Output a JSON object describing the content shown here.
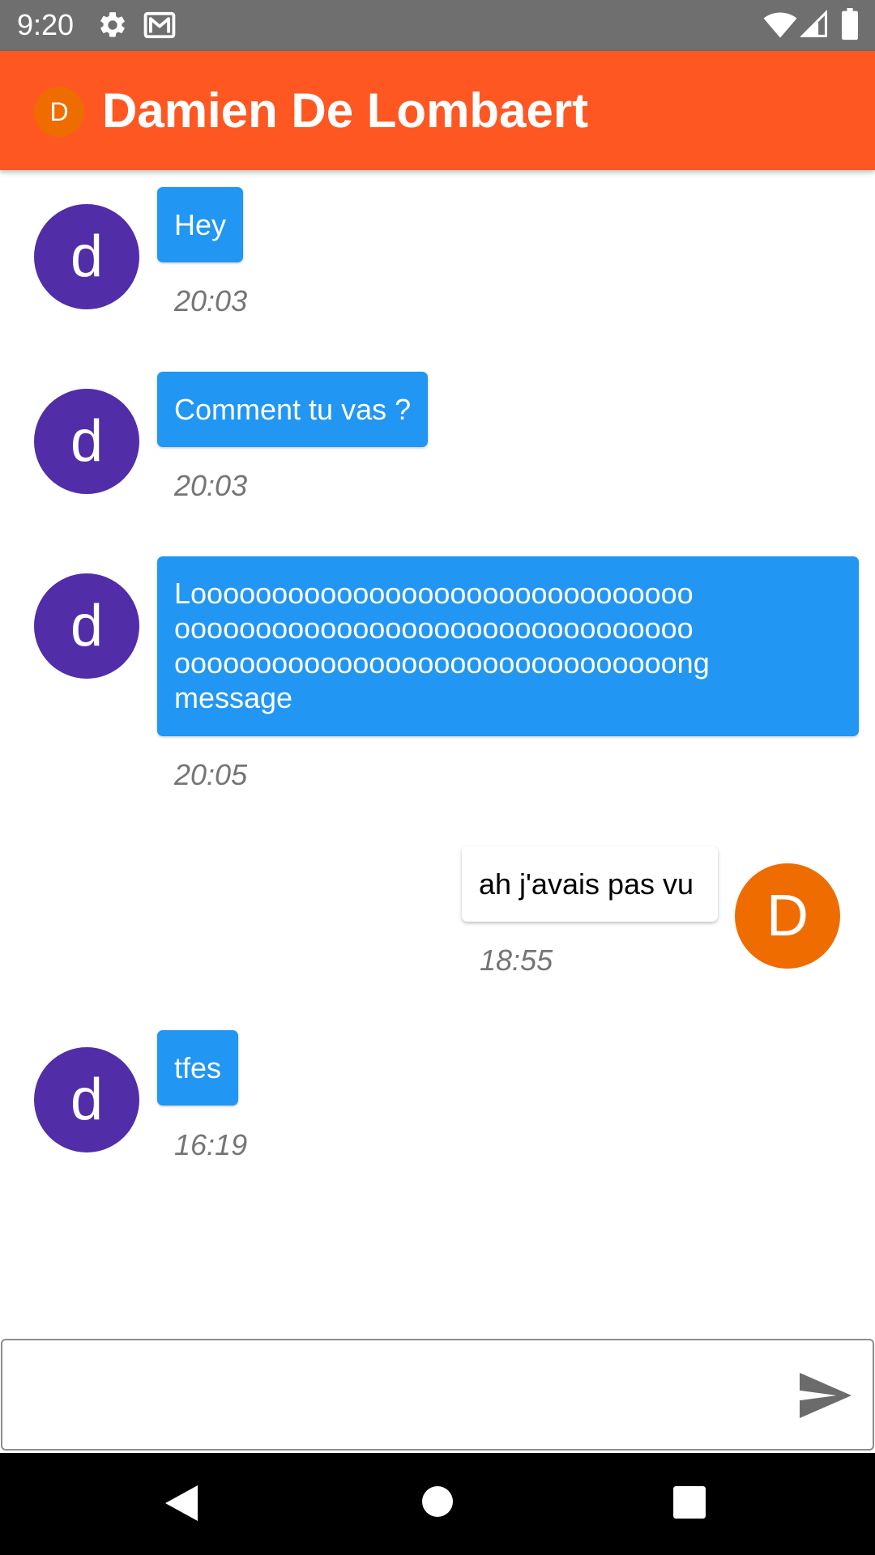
{
  "status_bar": {
    "time": "9:20",
    "icons": [
      "settings-icon",
      "gmail-icon",
      "wifi-icon",
      "cell-signal-icon",
      "battery-icon"
    ]
  },
  "app_bar": {
    "avatar_letter": "D",
    "title": "Damien De Lombaert",
    "color": "#ff5722",
    "avatar_color": "#ef6c00"
  },
  "messages": [
    {
      "direction": "incoming",
      "avatar_letter": "d",
      "text": "Hey",
      "time": "20:03"
    },
    {
      "direction": "incoming",
      "avatar_letter": "d",
      "text": "Comment tu vas ?",
      "time": "20:03"
    },
    {
      "direction": "incoming",
      "avatar_letter": "d",
      "text_lines": [
        "Looooooooooooooooooooooooooooooo",
        "oooooooooooooooooooooooooooooooo",
        "ooooooooooooooooooooooooooooooong",
        "message"
      ],
      "time": "20:05"
    },
    {
      "direction": "outgoing",
      "avatar_letter": "D",
      "text": "ah j'avais pas vu",
      "time": "18:55"
    },
    {
      "direction": "incoming",
      "avatar_letter": "d",
      "text": "tfes",
      "time": "16:19"
    }
  ],
  "colors": {
    "incoming_bubble": "#2196f3",
    "incoming_avatar": "#512da8",
    "outgoing_bubble": "#ffffff",
    "outgoing_avatar": "#ef6c00",
    "timestamp": "#757575"
  },
  "composer": {
    "value": "",
    "placeholder": "",
    "send_icon": "send-icon"
  },
  "nav_bar": {
    "icons": [
      "back-icon",
      "home-icon",
      "recents-icon"
    ]
  }
}
